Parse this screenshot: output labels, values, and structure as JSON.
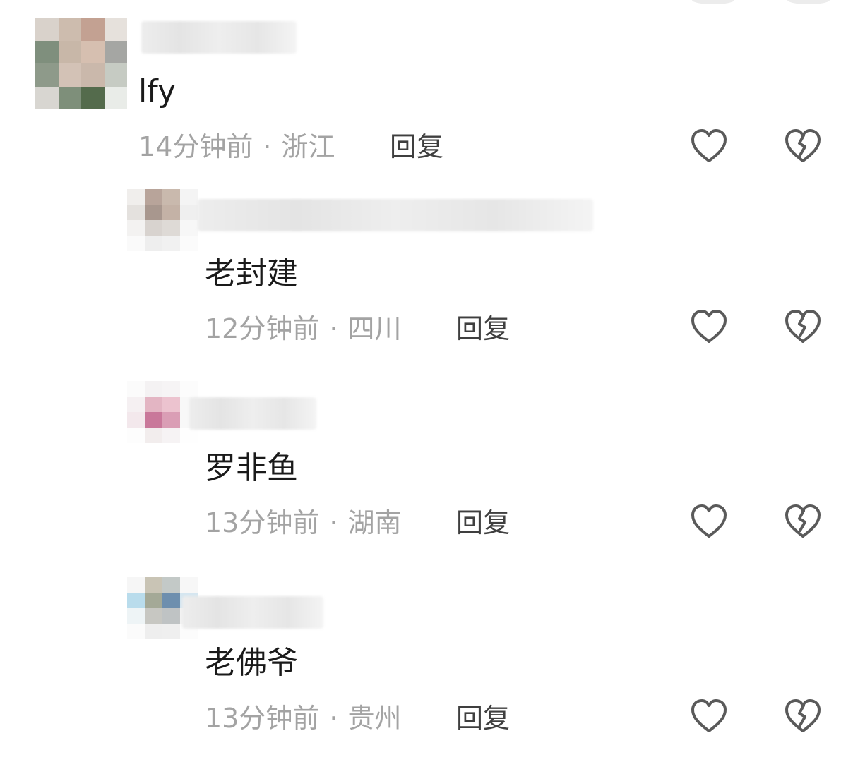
{
  "comments": [
    {
      "text": "lfy",
      "time": "14分钟前",
      "separator": "·",
      "location": "浙江",
      "reply_label": "回复",
      "avatar_colors": [
        "#d9d2cb",
        "#cdbcae",
        "#c3a192",
        "#e6e1dc",
        "#7f8f7d",
        "#c8b7a8",
        "#d6bfb0",
        "#a5a6a3",
        "#8e9a8a",
        "#d3c2b6",
        "#cab8ab",
        "#c6cbc3",
        "#d8d6d1",
        "#7e8f7a",
        "#546b4c",
        "#e9ece8"
      ]
    },
    {
      "text": "老封建",
      "time": "12分钟前",
      "separator": "·",
      "location": "四川",
      "reply_label": "回复",
      "avatar_colors": [
        "#f0eeec",
        "#b8a49a",
        "#c9b9ad",
        "#f4f4f4",
        "#e4e1de",
        "#a8978e",
        "#c4b2a6",
        "#efefef",
        "#f3f2f1",
        "#d8d3cf",
        "#dedad6",
        "#f7f7f7",
        "#fafafa",
        "#eeeeee",
        "#f1f1f1",
        "#fbfbfb"
      ]
    },
    {
      "text": "罗非鱼",
      "time": "13分钟前",
      "separator": "·",
      "location": "湖南",
      "reply_label": "回复",
      "avatar_colors": [
        "#fbfbfb",
        "#f4f2f3",
        "#f6f4f5",
        "#fcfcfc",
        "#f5f0f2",
        "#e3b5c3",
        "#ecc3cf",
        "#f8f8f8",
        "#f3e8ec",
        "#c9789a",
        "#da9eb5",
        "#f8f8f8",
        "#fdfdfd",
        "#f2eded",
        "#f6f3f4",
        "#fefefe"
      ]
    },
    {
      "text": "老佛爷",
      "time": "13分钟前",
      "separator": "·",
      "location": "贵州",
      "reply_label": "回复",
      "avatar_colors": [
        "#f6f6f6",
        "#c9c4b5",
        "#c3c9c7",
        "#f7f7f7",
        "#b9dcec",
        "#a4a997",
        "#6e8fae",
        "#d5e6f0",
        "#eef4f6",
        "#c7c7c2",
        "#bfc3c4",
        "#f3f3f3",
        "#fbfbfb",
        "#eeeeee",
        "#efefef",
        "#fcfcfc"
      ]
    }
  ],
  "colors": {
    "content": "#1a1a1a",
    "meta": "#a3a3a3",
    "reply": "#3f3f3f",
    "icon": "#5a5a5a"
  },
  "icons": {
    "like": "heart-outline-icon",
    "dislike": "broken-heart-outline-icon"
  }
}
